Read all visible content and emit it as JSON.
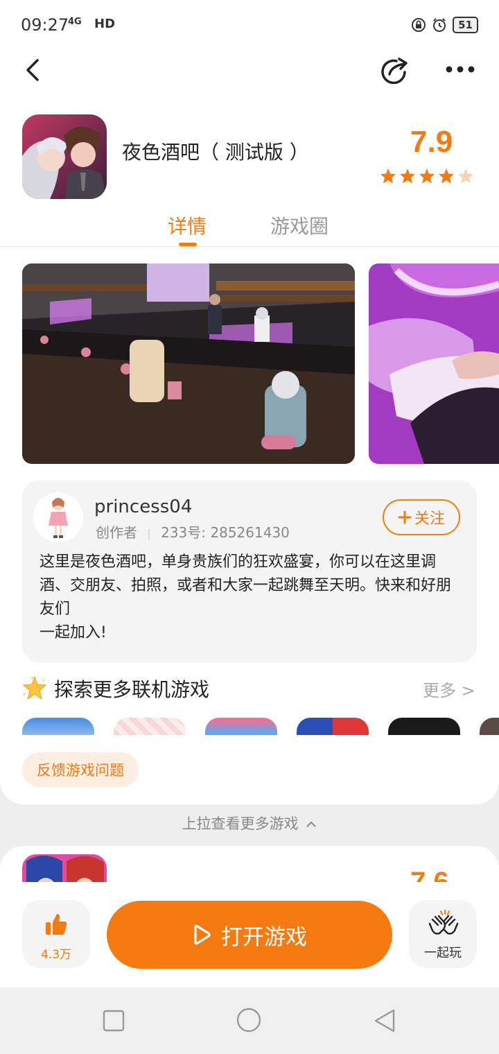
{
  "status_bar": {
    "time": "09:27",
    "network": "4G",
    "hd": "HD",
    "battery": "51"
  },
  "app": {
    "title": "夜色酒吧（ 测试版 ）",
    "score": "7.9",
    "stars": 4.5
  },
  "tabs": [
    {
      "label": "详情"
    },
    {
      "label": "游戏圈"
    }
  ],
  "creator": {
    "name": "princess04",
    "role": "创作者",
    "id_text": "233号: 285261430",
    "follow_label": "关注"
  },
  "description": "这里是夜色酒吧，单身贵族们的狂欢盛宴，你可以在这里调酒、交朋友、拍照，或者和大家一起跳舞至天明。快来和好朋友们\n一起加入!",
  "section": {
    "title": "探索更多联机游戏",
    "more_label": "更多 >"
  },
  "feedback_label": "反馈游戏问题",
  "pullup_hint": "上拉查看更多游戏",
  "next_game": {
    "score": "7.6"
  },
  "actions": {
    "like_count": "4.3万",
    "open_label": "打开游戏",
    "together_label": "一起玩"
  },
  "colors": {
    "accent": "#f57a10"
  }
}
